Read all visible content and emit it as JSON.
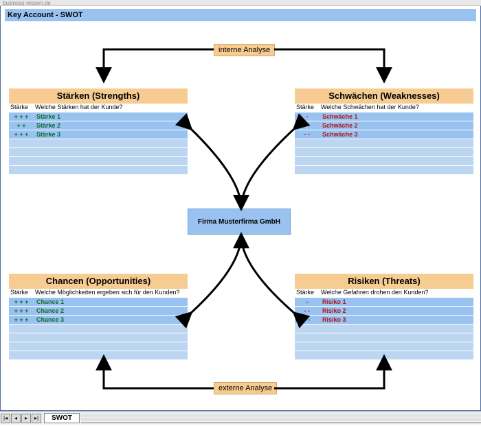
{
  "browser_text": "business-wissen.de",
  "title": "Key Account - SWOT",
  "label_internal": "interne Analyse",
  "label_external": "externe Analyse",
  "center": "Firma Musterfirma GmbH",
  "col_head1": "Stärke",
  "quadrants": {
    "tl": {
      "header": "Stärken (Strengths)",
      "question": "Welche Stärken hat der Kunde?",
      "items": [
        {
          "sym": "+ + +",
          "txt": "Stärke 1"
        },
        {
          "sym": "+ +",
          "txt": "Stärke 2"
        },
        {
          "sym": "+ + +",
          "txt": "Stärke 3"
        }
      ],
      "cls": "green"
    },
    "tr": {
      "header": "Schwächen (Weaknesses)",
      "question": "Welche Schwächen hat der Kunde?",
      "items": [
        {
          "sym": "-",
          "txt": "Schwäche 1"
        },
        {
          "sym": "- -",
          "txt": "Schwäche 2"
        },
        {
          "sym": "- -",
          "txt": "Schwäche 3"
        }
      ],
      "cls": "red"
    },
    "bl": {
      "header": "Chancen (Opportunities)",
      "question": "Welche Möglichkeiten ergeben sich für den Kunden?",
      "items": [
        {
          "sym": "+ + +",
          "txt": "Chance 1"
        },
        {
          "sym": "+ + +",
          "txt": "Chance 2"
        },
        {
          "sym": "+ + +",
          "txt": "Chance 3"
        }
      ],
      "cls": "green"
    },
    "br": {
      "header": "Risiken (Threats)",
      "question": "Welche Gefahren drohen den Kunden?",
      "items": [
        {
          "sym": "-",
          "txt": "Risiko 1"
        },
        {
          "sym": "- -",
          "txt": "Risiko 2"
        },
        {
          "sym": "- -",
          "txt": "Risiko 3"
        }
      ],
      "cls": "red"
    }
  },
  "sheet_tab": "SWOT",
  "nav": {
    "first": "|◂",
    "prev": "◂",
    "next": "▸",
    "last": "▸|"
  }
}
